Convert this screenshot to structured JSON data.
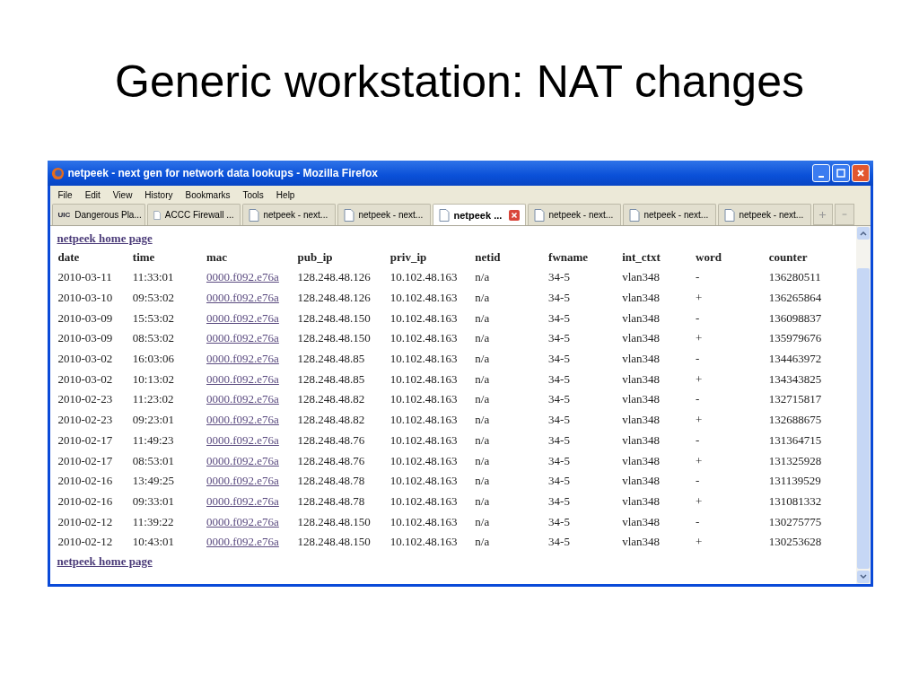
{
  "slide_title": "Generic workstation: NAT changes",
  "window": {
    "title": "netpeek - next gen for network data lookups - Mozilla Firefox"
  },
  "menu": [
    "File",
    "Edit",
    "View",
    "History",
    "Bookmarks",
    "Tools",
    "Help"
  ],
  "tabs": [
    {
      "logo": "UIC",
      "label": "Dangerous Pla...",
      "selected": false
    },
    {
      "label": "ACCC Firewall ...",
      "selected": false
    },
    {
      "label": "netpeek - next...",
      "selected": false
    },
    {
      "label": "netpeek - next...",
      "selected": false
    },
    {
      "label": "netpeek ...",
      "selected": true
    },
    {
      "label": "netpeek - next...",
      "selected": false
    },
    {
      "label": "netpeek - next...",
      "selected": false
    },
    {
      "label": "netpeek - next...",
      "selected": false
    }
  ],
  "page": {
    "top_link": "netpeek home page",
    "bottom_link": "netpeek home page",
    "table": {
      "columns": [
        "date",
        "time",
        "mac",
        "pub_ip",
        "priv_ip",
        "netid",
        "fwname",
        "int_ctxt",
        "word",
        "counter"
      ],
      "rows": [
        [
          "2010-03-11",
          "11:33:01",
          "0000.f092.e76a",
          "128.248.48.126",
          "10.102.48.163",
          "n/a",
          "34-5",
          "vlan348",
          "-",
          "136280511"
        ],
        [
          "2010-03-10",
          "09:53:02",
          "0000.f092.e76a",
          "128.248.48.126",
          "10.102.48.163",
          "n/a",
          "34-5",
          "vlan348",
          "+",
          "136265864"
        ],
        [
          "2010-03-09",
          "15:53:02",
          "0000.f092.e76a",
          "128.248.48.150",
          "10.102.48.163",
          "n/a",
          "34-5",
          "vlan348",
          "-",
          "136098837"
        ],
        [
          "2010-03-09",
          "08:53:02",
          "0000.f092.e76a",
          "128.248.48.150",
          "10.102.48.163",
          "n/a",
          "34-5",
          "vlan348",
          "+",
          "135979676"
        ],
        [
          "2010-03-02",
          "16:03:06",
          "0000.f092.e76a",
          "128.248.48.85",
          "10.102.48.163",
          "n/a",
          "34-5",
          "vlan348",
          "-",
          "134463972"
        ],
        [
          "2010-03-02",
          "10:13:02",
          "0000.f092.e76a",
          "128.248.48.85",
          "10.102.48.163",
          "n/a",
          "34-5",
          "vlan348",
          "+",
          "134343825"
        ],
        [
          "2010-02-23",
          "11:23:02",
          "0000.f092.e76a",
          "128.248.48.82",
          "10.102.48.163",
          "n/a",
          "34-5",
          "vlan348",
          "-",
          "132715817"
        ],
        [
          "2010-02-23",
          "09:23:01",
          "0000.f092.e76a",
          "128.248.48.82",
          "10.102.48.163",
          "n/a",
          "34-5",
          "vlan348",
          "+",
          "132688675"
        ],
        [
          "2010-02-17",
          "11:49:23",
          "0000.f092.e76a",
          "128.248.48.76",
          "10.102.48.163",
          "n/a",
          "34-5",
          "vlan348",
          "-",
          "131364715"
        ],
        [
          "2010-02-17",
          "08:53:01",
          "0000.f092.e76a",
          "128.248.48.76",
          "10.102.48.163",
          "n/a",
          "34-5",
          "vlan348",
          "+",
          "131325928"
        ],
        [
          "2010-02-16",
          "13:49:25",
          "0000.f092.e76a",
          "128.248.48.78",
          "10.102.48.163",
          "n/a",
          "34-5",
          "vlan348",
          "-",
          "131139529"
        ],
        [
          "2010-02-16",
          "09:33:01",
          "0000.f092.e76a",
          "128.248.48.78",
          "10.102.48.163",
          "n/a",
          "34-5",
          "vlan348",
          "+",
          "131081332"
        ],
        [
          "2010-02-12",
          "11:39:22",
          "0000.f092.e76a",
          "128.248.48.150",
          "10.102.48.163",
          "n/a",
          "34-5",
          "vlan348",
          "-",
          "130275775"
        ],
        [
          "2010-02-12",
          "10:43:01",
          "0000.f092.e76a",
          "128.248.48.150",
          "10.102.48.163",
          "n/a",
          "34-5",
          "vlan348",
          "+",
          "130253628"
        ]
      ]
    }
  }
}
